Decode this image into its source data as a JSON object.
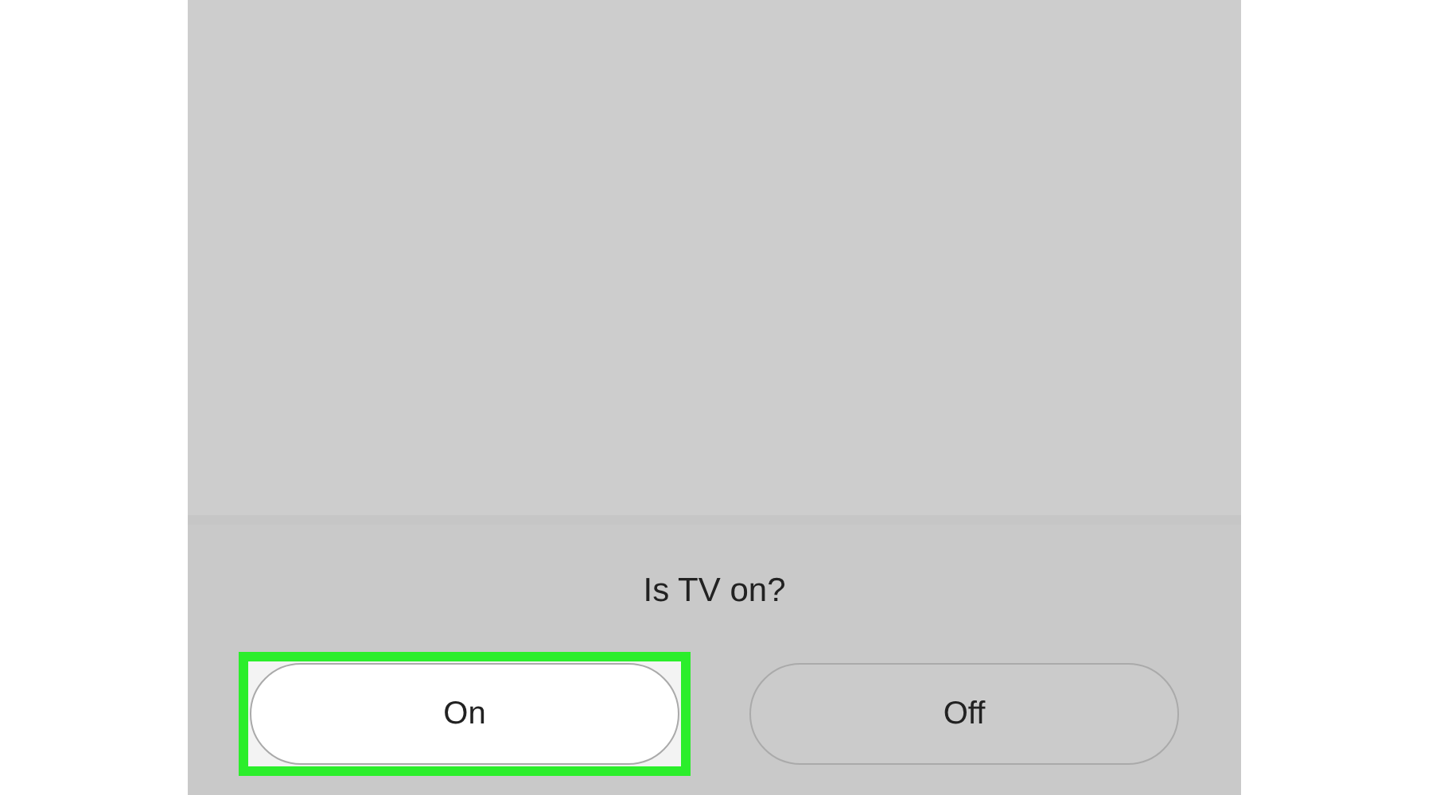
{
  "dialog": {
    "question": "Is TV on?",
    "buttons": [
      {
        "label": "On",
        "selected": true,
        "highlighted": true
      },
      {
        "label": "Off",
        "selected": false,
        "highlighted": false
      }
    ]
  }
}
